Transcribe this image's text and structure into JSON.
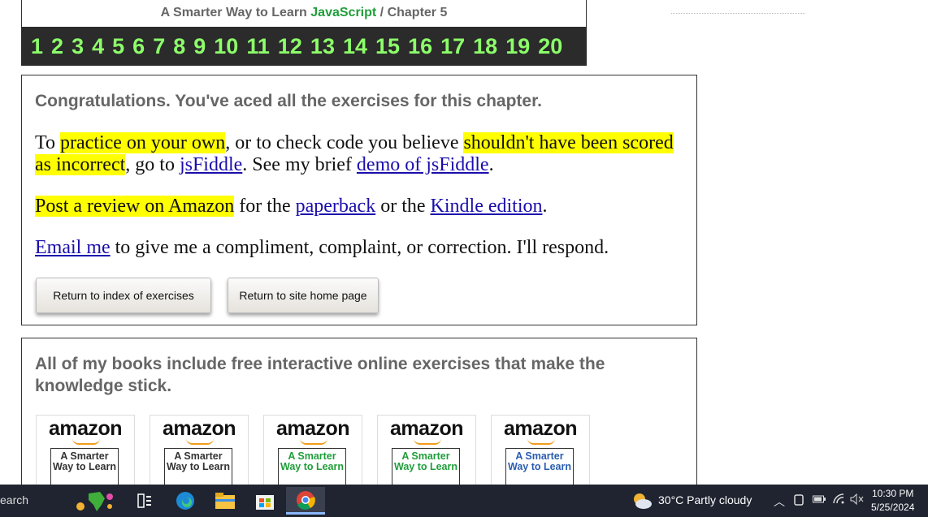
{
  "header": {
    "title_prefix": "A Smarter Way to Learn",
    "title_highlight": "JavaScript",
    "separator": "/",
    "chapter": "Chapter 5"
  },
  "chapters": [
    "1",
    "2",
    "3",
    "4",
    "5",
    "6",
    "7",
    "8",
    "9",
    "10",
    "11",
    "12",
    "13",
    "14",
    "15",
    "16",
    "17",
    "18",
    "19",
    "20"
  ],
  "congrats": {
    "heading": "Congratulations. You've aced all the exercises for this chapter.",
    "p1": {
      "t1": "To ",
      "h1": "practice on your own",
      "t2": ", or to check code you believe ",
      "h2": "shouldn't have been scored as incorrect",
      "t3": ", go to ",
      "link1": "jsFiddle",
      "t4": ". See my brief ",
      "link2": "demo of jsFiddle",
      "t5": "."
    },
    "p2": {
      "h1": "Post a review on Amazon",
      "t1": " for the ",
      "link1": "paperback",
      "t2": " or the ",
      "link2": "Kindle edition",
      "t3": "."
    },
    "p3": {
      "link1": "Email me",
      "t1": " to give me a compliment, complaint, or correction. I'll respond."
    },
    "buttons": {
      "index": "Return to index of exercises",
      "home": "Return to site home page"
    }
  },
  "books": {
    "heading": "All of my books include free interactive online exercises that make the knowledge stick.",
    "items": [
      {
        "brand": "amazon",
        "cover": "A Smarter Way to Learn",
        "color": "#333333"
      },
      {
        "brand": "amazon",
        "cover": "A Smarter Way to Learn",
        "color": "#333333"
      },
      {
        "brand": "amazon",
        "cover": "A Smarter Way to Learn",
        "color": "#1f9e3a"
      },
      {
        "brand": "amazon",
        "cover": "A Smarter Way to Learn",
        "color": "#1f9e3a"
      },
      {
        "brand": "amazon",
        "cover": "A Smarter Way to Learn",
        "color": "#2a5db0"
      }
    ]
  },
  "taskbar": {
    "search": "earch",
    "weather": "30°C  Partly cloudy",
    "time": "10:30 PM",
    "date": "5/25/2024"
  }
}
